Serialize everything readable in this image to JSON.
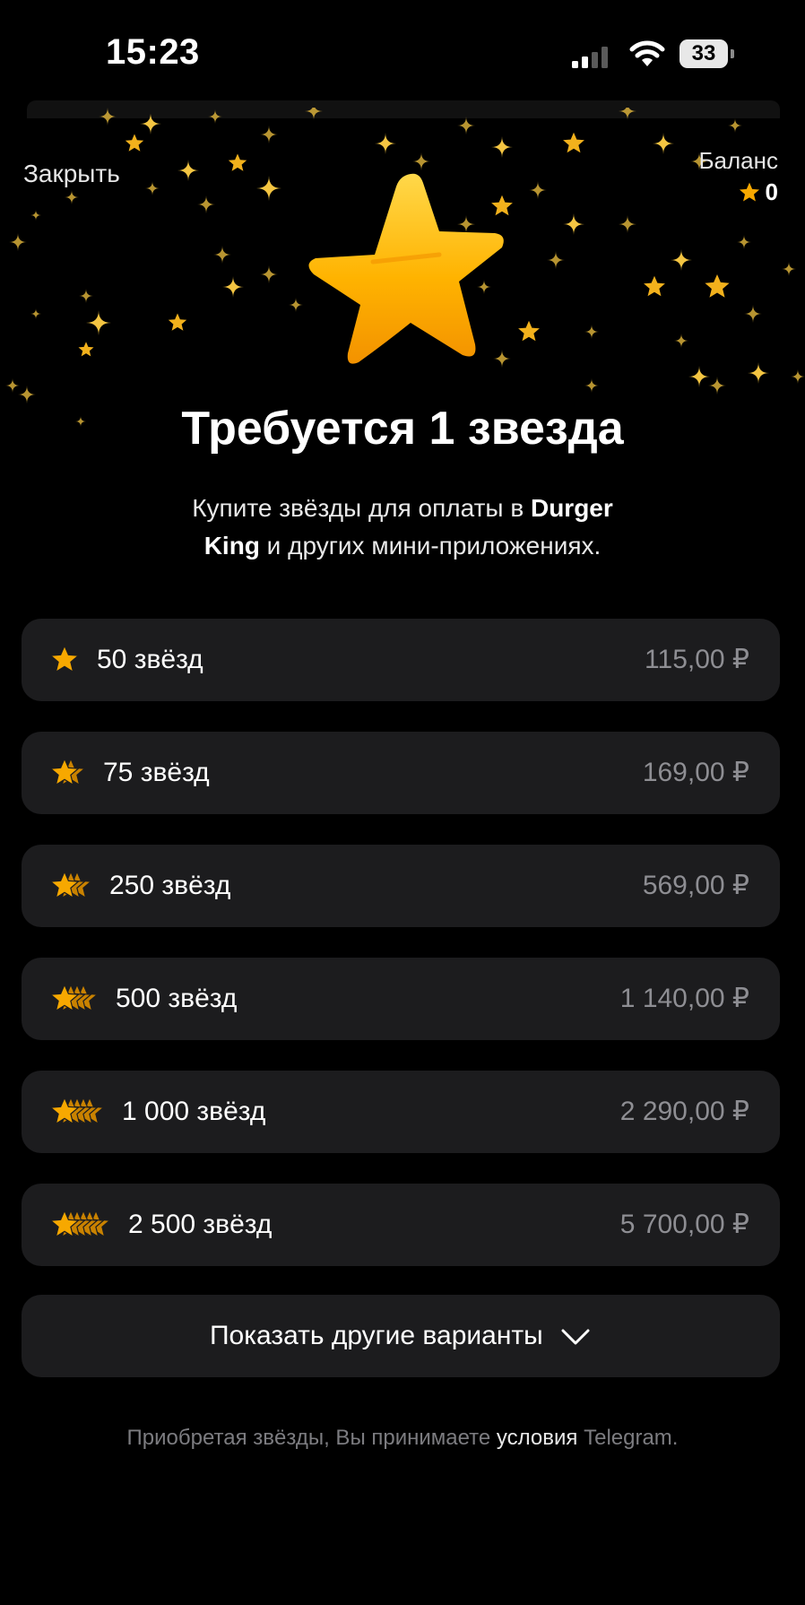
{
  "status_bar": {
    "time": "15:23",
    "battery": "33"
  },
  "header": {
    "close_label": "Закрыть",
    "balance_label": "Баланс",
    "balance_value": "0"
  },
  "title": "Требуется 1 звезда",
  "subtitle": {
    "line1_prefix": "Купите звёзды для оплаты в ",
    "line1_bold": "Durger",
    "line2_bold": "King",
    "line2_suffix": " и других мини-приложениях."
  },
  "options": [
    {
      "label": "50 звёзд",
      "price": "115,00 ₽",
      "stars": 1
    },
    {
      "label": "75 звёзд",
      "price": "169,00 ₽",
      "stars": 2
    },
    {
      "label": "250 звёзд",
      "price": "569,00 ₽",
      "stars": 3
    },
    {
      "label": "500 звёзд",
      "price": "1 140,00 ₽",
      "stars": 4
    },
    {
      "label": "1 000 звёзд",
      "price": "2 290,00 ₽",
      "stars": 5
    },
    {
      "label": "2 500 звёзд",
      "price": "5 700,00 ₽",
      "stars": 6
    }
  ],
  "more_button_label": "Показать другие варианты",
  "footer": {
    "prefix": "Приобретая звёзды, Вы принимаете ",
    "link": "условия",
    "suffix": " Telegram."
  },
  "colors": {
    "accent_star": "#f7a800",
    "row_bg": "#1c1c1e",
    "price_gray": "#8e8e93"
  }
}
